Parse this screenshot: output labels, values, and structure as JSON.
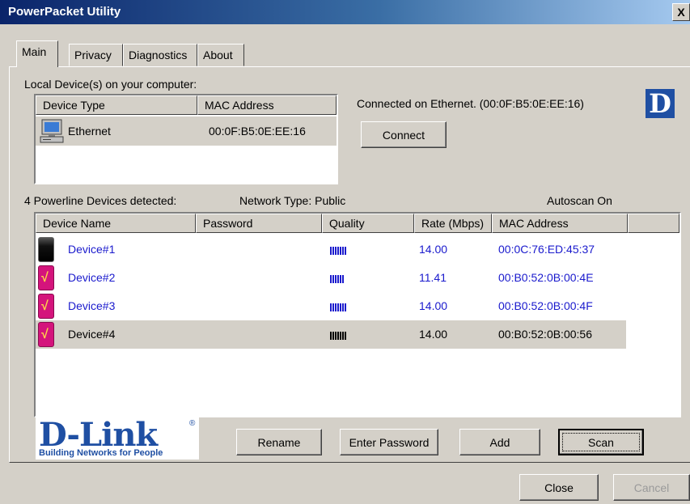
{
  "window": {
    "title": "PowerPacket Utility",
    "close_glyph": "X"
  },
  "tabs": [
    {
      "label": "Main"
    },
    {
      "label": "Privacy"
    },
    {
      "label": "Diagnostics"
    },
    {
      "label": "About"
    }
  ],
  "local": {
    "heading": "Local Device(s) on your computer:",
    "col_device_type": "Device Type",
    "col_mac": "MAC Address",
    "rows": [
      {
        "type": "Ethernet",
        "mac": "00:0F:B5:0E:EE:16"
      }
    ]
  },
  "connection": {
    "status": "Connected on Ethernet. (00:0F:B5:0E:EE:16)",
    "connect_label": "Connect"
  },
  "brand": {
    "corner_logo": "D",
    "logo_text": "D-Link",
    "registered": "®",
    "tagline": "Building Networks for People"
  },
  "powerline": {
    "detected": "4 Powerline Devices detected:",
    "network_type": "Network Type: Public",
    "autoscan": "Autoscan On",
    "columns": {
      "name": "Device Name",
      "password": "Password",
      "quality": "Quality",
      "rate": "Rate (Mbps)",
      "mac": "MAC Address"
    },
    "devices": [
      {
        "name": "Device#1",
        "password": "",
        "quality_bars": 7,
        "rate": "14.00",
        "mac": "00:0C:76:ED:45:37",
        "icon": "adapter-black-icon"
      },
      {
        "name": "Device#2",
        "password": "",
        "quality_bars": 6,
        "rate": "11.41",
        "mac": "00:B0:52:0B:00:4E",
        "icon": "adapter-pink-icon"
      },
      {
        "name": "Device#3",
        "password": "",
        "quality_bars": 7,
        "rate": "14.00",
        "mac": "00:B0:52:0B:00:4F",
        "icon": "adapter-pink-icon"
      },
      {
        "name": "Device#4",
        "password": "",
        "quality_bars": 7,
        "rate": "14.00",
        "mac": "00:B0:52:0B:00:56",
        "icon": "adapter-pink-icon",
        "selected": true
      }
    ]
  },
  "actions": {
    "rename": "Rename",
    "enter_password": "Enter Password",
    "add": "Add",
    "scan": "Scan"
  },
  "footer": {
    "close": "Close",
    "cancel": "Cancel"
  },
  "colors": {
    "face": "#d4d0c8",
    "link_blue": "#1a1acd",
    "dlink_blue": "#1f4fa3",
    "title_dark": "#0a246a"
  }
}
